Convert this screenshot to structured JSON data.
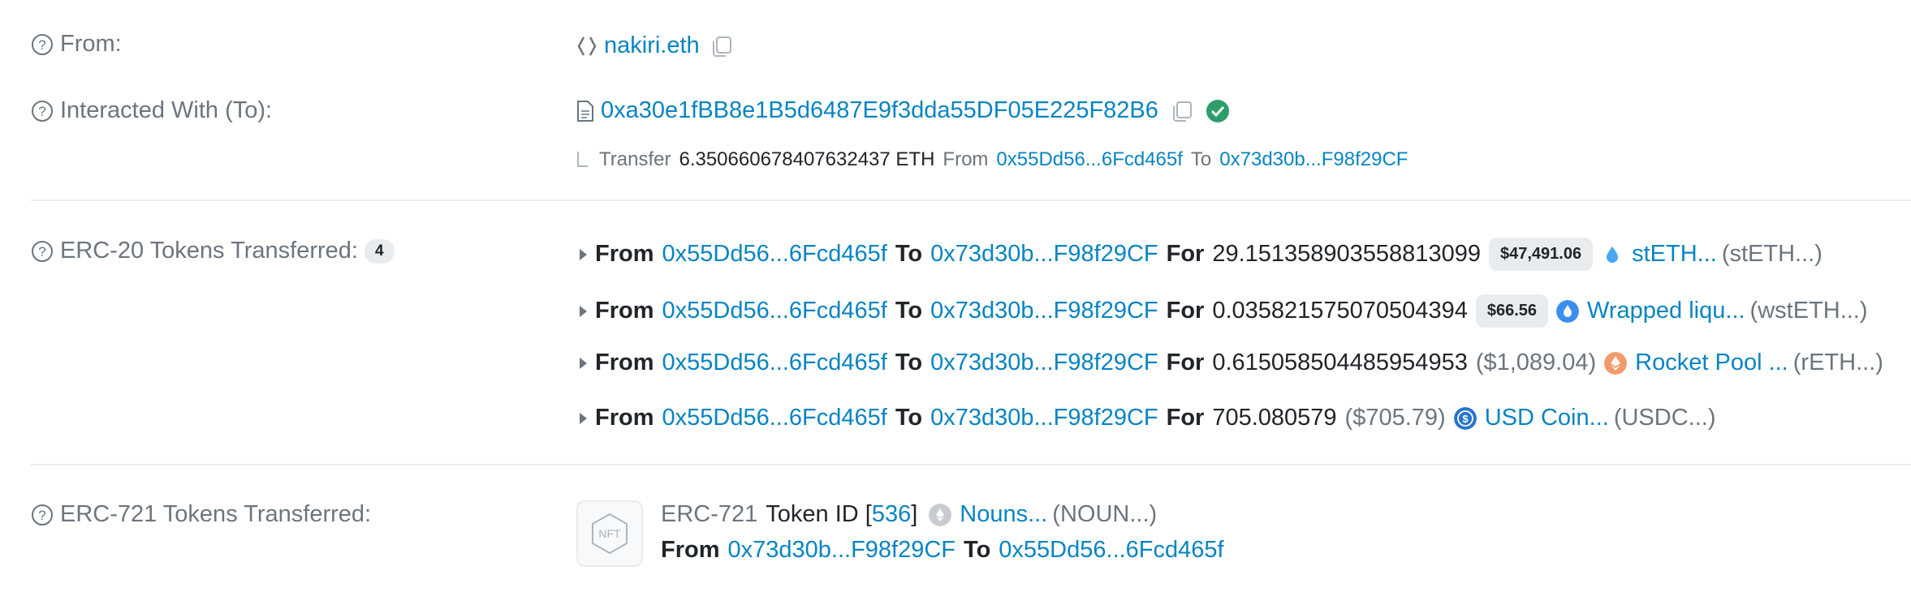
{
  "from": {
    "label": "From:",
    "value": "nakiri.eth"
  },
  "interacted": {
    "label": "Interacted With (To):",
    "address": "0xa30e1fBB8e1B5d6487E9f3dda55DF05E225F82B6",
    "transfer": {
      "word": "Transfer",
      "amount": "6.350660678407632437 ETH",
      "from_word": "From",
      "from_addr": "0x55Dd56...6Fcd465f",
      "to_word": "To",
      "to_addr": "0x73d30b...F98f29CF"
    }
  },
  "erc20": {
    "label": "ERC-20 Tokens Transferred:",
    "count": "4",
    "from_word": "From",
    "to_word": "To",
    "for_word": "For",
    "rows": [
      {
        "from": "0x55Dd56...6Fcd465f",
        "to": "0x73d30b...F98f29CF",
        "amount": "29.151358903558813099",
        "price": "$47,491.06",
        "token": "stETH...",
        "symbol": "(stETH...)",
        "icon": "steth-icon",
        "color": "#00a3ff"
      },
      {
        "from": "0x55Dd56...6Fcd465f",
        "to": "0x73d30b...F98f29CF",
        "amount": "0.035821575070504394",
        "price": "$66.56",
        "token": "Wrapped liqu...",
        "symbol": "(wstETH...)",
        "icon": "wsteth-icon",
        "color": "#3a8ef0"
      },
      {
        "from": "0x55Dd56...6Fcd465f",
        "to": "0x73d30b...F98f29CF",
        "amount": "0.615058504485954953",
        "price": "($1,089.04)",
        "token": "Rocket Pool ...",
        "symbol": "(rETH...)",
        "icon": "reth-icon",
        "color": "#f29a6b"
      },
      {
        "from": "0x55Dd56...6Fcd465f",
        "to": "0x73d30b...F98f29CF",
        "amount": "705.080579",
        "price": "($705.79)",
        "token": "USD Coin...",
        "symbol": "(USDC...)",
        "icon": "usdc-icon",
        "color": "#2775ca"
      }
    ]
  },
  "erc721": {
    "label": "ERC-721 Tokens Transferred:",
    "nft_text": "NFT",
    "standard": "ERC-721",
    "token_id_word": "Token ID [",
    "token_id": "536",
    "bracket_close": "]",
    "name": "Nouns...",
    "symbol": "(NOUN...)",
    "from_word": "From",
    "from_addr": "0x73d30b...F98f29CF",
    "to_word": "To",
    "to_addr": "0x55Dd56...6Fcd465f"
  }
}
